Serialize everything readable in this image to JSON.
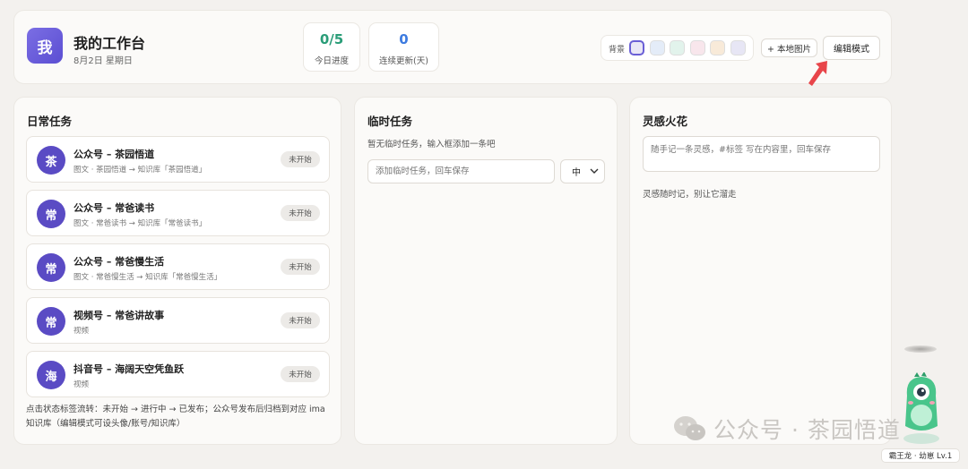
{
  "header": {
    "avatar_char": "我",
    "title": "我的工作台",
    "date": "8月2日 星期日",
    "stats": [
      {
        "value": "0/5",
        "label": "今日进度"
      },
      {
        "value": "0",
        "label": "连续更新(天)"
      }
    ],
    "bg_label": "背景",
    "bg_swatches": [
      "#e9e7f6",
      "#e4ecf8",
      "#e2f3ec",
      "#f8e6ec",
      "#f8ead9",
      "#e7e6f5"
    ],
    "local_image_label": "+ 本地图片",
    "edit_mode_label": "编辑模式"
  },
  "daily": {
    "title": "日常任务",
    "tasks": [
      {
        "avatar": "茶",
        "name": "公众号 – 茶园悟道",
        "sub": "图文 · 茶园悟道 → 知识库「茶园悟道」",
        "status": "未开始"
      },
      {
        "avatar": "常",
        "name": "公众号 – 常爸读书",
        "sub": "图文 · 常爸读书 → 知识库「常爸读书」",
        "status": "未开始"
      },
      {
        "avatar": "常",
        "name": "公众号 – 常爸慢生活",
        "sub": "图文 · 常爸慢生活 → 知识库「常爸慢生活」",
        "status": "未开始"
      },
      {
        "avatar": "常",
        "name": "视频号 – 常爸讲故事",
        "sub": "视频",
        "status": "未开始"
      },
      {
        "avatar": "海",
        "name": "抖音号 – 海阔天空凭鱼跃",
        "sub": "视频",
        "status": "未开始"
      }
    ],
    "note": "点击状态标签流转：未开始 → 进行中 → 已发布；公众号发布后归档到对应 ima 知识库（编辑模式可设头像/账号/知识库）"
  },
  "temp": {
    "title": "临时任务",
    "hint": "暂无临时任务，输入框添加一条吧",
    "input_placeholder": "添加临时任务，回车保存",
    "priority_value": "中"
  },
  "idea": {
    "title": "灵感火花",
    "input_placeholder": "随手记一条灵感，#标签 写在内容里，回车保存",
    "hint": "灵感随时记，别让它溜走"
  },
  "watermark": "公众号 · 茶园悟道",
  "mascot_level": "霸王龙 · 幼崽 Lv.1",
  "colors": {
    "accent": "#5a4bc4",
    "progress": "#2a9d78",
    "streak": "#3d7be0",
    "arrow": "#e8454a"
  }
}
